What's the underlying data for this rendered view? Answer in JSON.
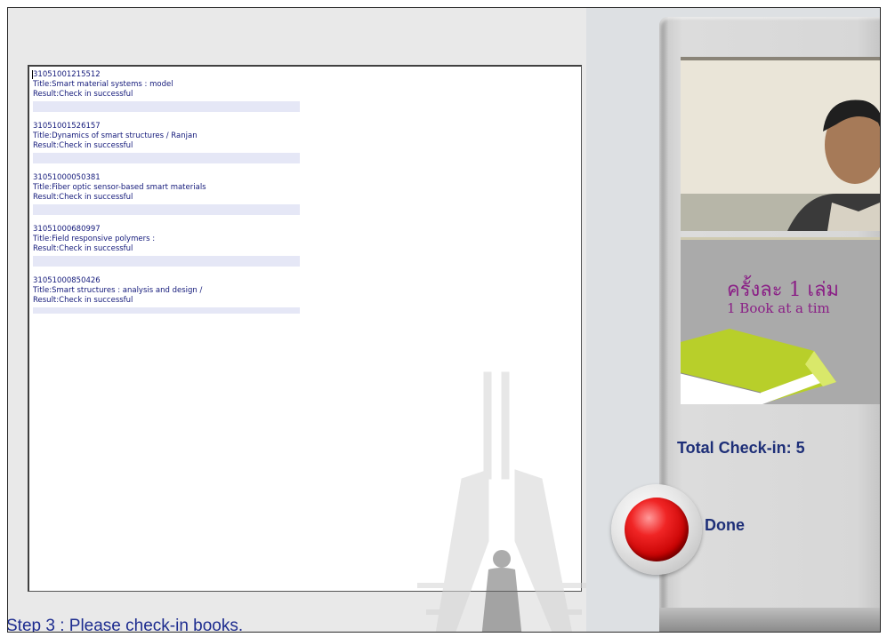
{
  "checkin_list": {
    "entries": [
      {
        "barcode": "31051001215512",
        "title": "Title:Smart material systems : model",
        "result": "Result:Check in successful"
      },
      {
        "barcode": "31051001526157",
        "title": "Title:Dynamics of smart structures / Ranjan",
        "result": "Result:Check in successful"
      },
      {
        "barcode": "31051000050381",
        "title": "Title:Fiber optic sensor-based smart materials",
        "result": "Result:Check in successful"
      },
      {
        "barcode": "31051000680997",
        "title": "Title:Field responsive polymers :",
        "result": "Result:Check in successful"
      },
      {
        "barcode": "31051000850426",
        "title": "Title:Smart structures : analysis and design /",
        "result": "Result:Check in successful"
      }
    ]
  },
  "step_label": "Step 3 : Please check-in books.",
  "banner": {
    "thai_text": "ครั้งละ 1 เล่ม",
    "english_text": "1 Book at a tim"
  },
  "total_checkin": "Total Check-in: 5",
  "done_label": "Done",
  "colors": {
    "text_blue": "#1e2f78",
    "done_red": "#d80000",
    "banner_purple": "#8a1f86"
  }
}
